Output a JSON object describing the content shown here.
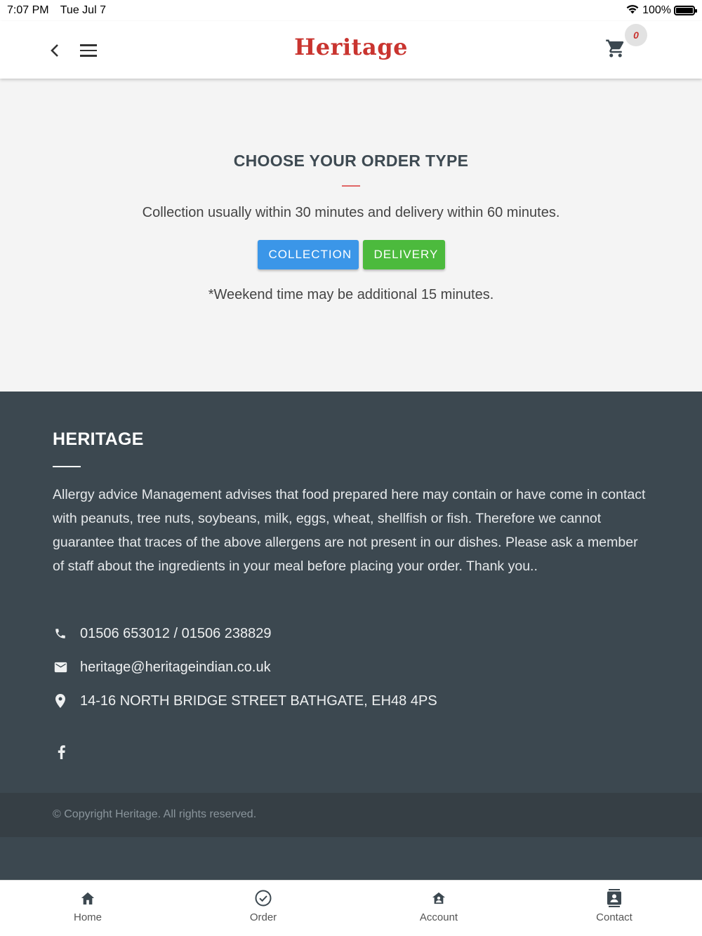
{
  "status_bar": {
    "time": "7:07 PM",
    "date": "Tue Jul 7",
    "battery": "100%",
    "battery_level": 1.0
  },
  "header": {
    "brand": "Heritage",
    "cart_count": "0"
  },
  "order": {
    "title": "CHOOSE YOUR ORDER TYPE",
    "info": "Collection usually within 30 minutes and delivery within 60 minutes.",
    "collection_label": "COLLECTION",
    "delivery_label": "DELIVERY",
    "note": "*Weekend time may be additional 15 minutes."
  },
  "footer": {
    "title": "HERITAGE",
    "allergy_text": "Allergy advice Management advises that food prepared here may contain or have come in contact with peanuts, tree nuts, soybeans, milk, eggs, wheat, shellfish or fish. Therefore we cannot guarantee that traces of the above allergens are not present in our dishes. Please ask a member of staff about the ingredients in your meal before placing your order. Thank you..",
    "phone": "01506 653012 / 01506 238829",
    "email": "heritage@heritageindian.co.uk",
    "address": "14-16 NORTH BRIDGE STREET BATHGATE, EH48 4PS",
    "copyright": "© Copyright Heritage. All rights reserved."
  },
  "tabs": [
    {
      "label": "Home",
      "icon": "home-icon"
    },
    {
      "label": "Order",
      "icon": "check-circle-icon"
    },
    {
      "label": "Account",
      "icon": "account-icon"
    },
    {
      "label": "Contact",
      "icon": "contact-icon"
    }
  ],
  "colors": {
    "brand": "#c9342f",
    "collection": "#3b96e8",
    "delivery": "#4cba3d",
    "footer_bg": "#3c4850",
    "copyright_bg": "#363f45"
  }
}
